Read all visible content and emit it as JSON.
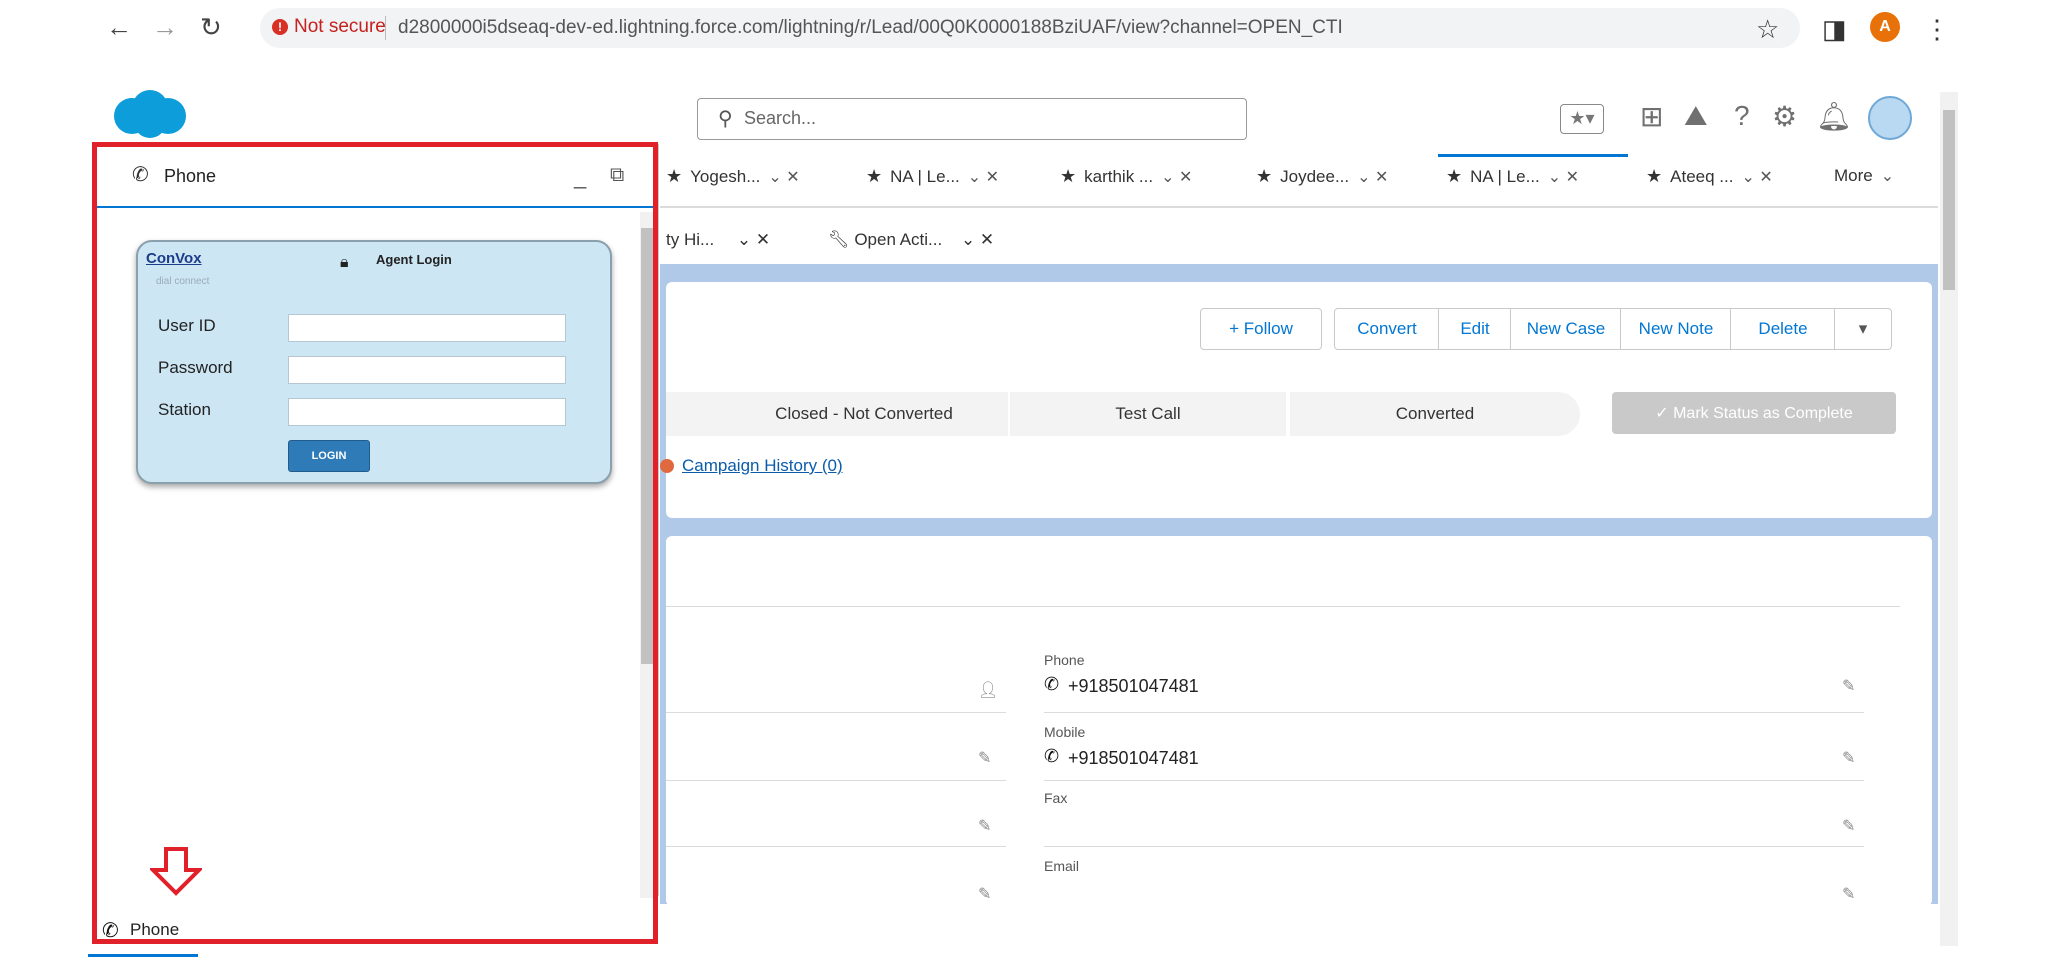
{
  "browser": {
    "not_secure": "Not secure",
    "url": "d2800000i5dseaq-dev-ed.lightning.force.com/lightning/r/Lead/00Q0K0000188BziUAF/view?channel=OPEN_CTI",
    "avatar_letter": "A"
  },
  "header": {
    "search_placeholder": "Search..."
  },
  "tabs": [
    {
      "label": "Yogesh..."
    },
    {
      "label": "NA | Le..."
    },
    {
      "label": "karthik ..."
    },
    {
      "label": "Joydee..."
    },
    {
      "label": "NA | Le..."
    },
    {
      "label": "Ateeq ..."
    }
  ],
  "more_tab": "More",
  "subtabs": [
    {
      "label": "ty Hi..."
    },
    {
      "label": "Open Acti..."
    }
  ],
  "actions": {
    "follow": "+ Follow",
    "convert": "Convert",
    "edit": "Edit",
    "new_case": "New Case",
    "new_note": "New Note",
    "delete": "Delete"
  },
  "path": {
    "steps": [
      "Closed - Not Converted",
      "Test Call",
      "Converted"
    ],
    "mark_complete": "✓ Mark Status as Complete"
  },
  "campaign_history": "Campaign History (0)",
  "fields": {
    "phone_label": "Phone",
    "phone_value": "+918501047481",
    "mobile_label": "Mobile",
    "mobile_value": "+918501047481",
    "fax_label": "Fax",
    "email_label": "Email"
  },
  "softphone": {
    "title": "Phone",
    "brand": "ConVox",
    "brand_sub": "dial connect",
    "agent_login": "Agent Login",
    "user_id_label": "User ID",
    "password_label": "Password",
    "station_label": "Station",
    "login_button": "LOGIN"
  },
  "dock": {
    "label": "Phone"
  },
  "colors": {
    "brand_blue": "#0176d3",
    "highlight_red": "#e0212a",
    "page_background": "#b0c9e8"
  }
}
